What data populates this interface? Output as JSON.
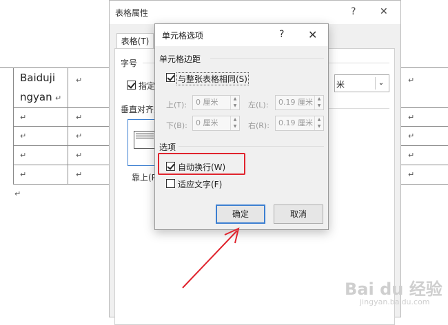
{
  "document": {
    "cell_text_line1": "Baiduji",
    "cell_text_line2": "ngyan",
    "cell_mark": "↵"
  },
  "back_dialog": {
    "title": "表格属性",
    "help": "?",
    "close": "✕",
    "tab_label": "表格(T)",
    "font_size_label": "字号",
    "specify_label": "指定",
    "vertical_align_label": "垂直对齐方",
    "top_align_label": "靠上(P",
    "dropdown_value": "米"
  },
  "front_dialog": {
    "title": "单元格选项",
    "help": "?",
    "close": "✕",
    "margins_section": "单元格边距",
    "same_as_table_label": "与整张表格相同(S)",
    "top_label": "上(T):",
    "top_value": "0 厘米",
    "left_label": "左(L):",
    "left_value": "0.19 厘米",
    "bottom_label": "下(B):",
    "bottom_value": "0 厘米",
    "right_label": "右(R):",
    "right_value": "0.19 厘米",
    "options_section": "选项",
    "wrap_text_label": "自动换行(W)",
    "fit_text_label": "适应文字(F)",
    "ok_label": "确定",
    "cancel_label": "取消"
  },
  "watermark": {
    "brand": "Bai du 经验",
    "url": "jingyan.baidu.com"
  },
  "colors": {
    "highlight": "#e0232d",
    "arrow": "#e0232d",
    "primary_border": "#3c7fd1"
  }
}
